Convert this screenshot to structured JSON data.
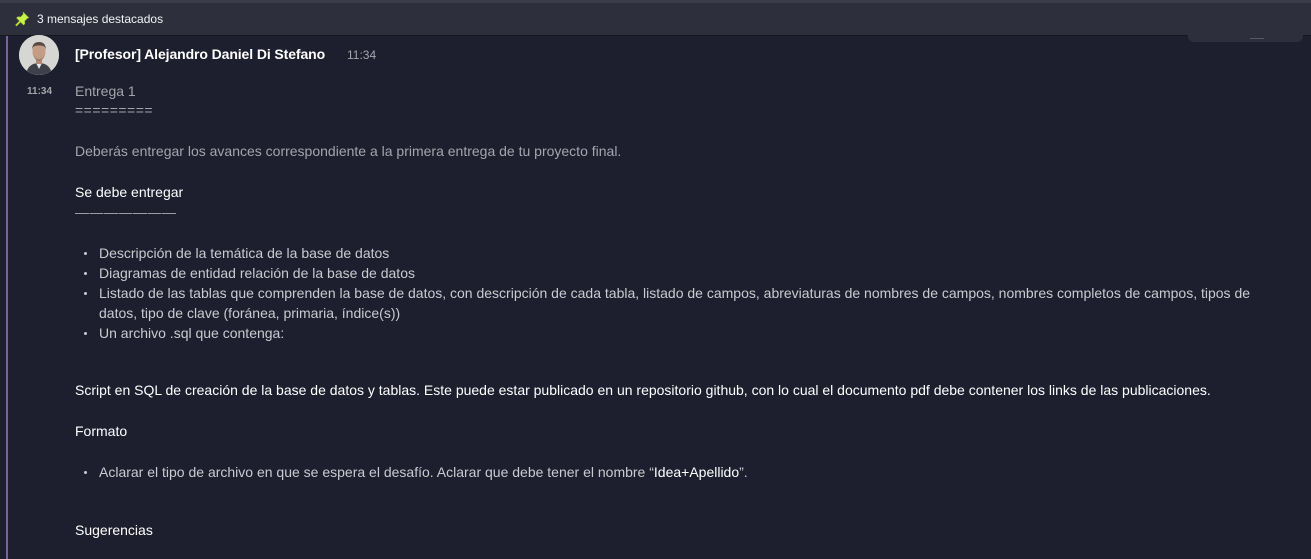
{
  "pinned": {
    "label": "3 mensajes destacados"
  },
  "message": {
    "author": "[Profesor] Alejandro Daniel Di Stefano",
    "timestamp": "11:34",
    "gutter_timestamp": "11:34",
    "title": "Entrega 1",
    "title_underline": "=========",
    "intro": "Deberás entregar los avances correspondiente a la primera entrega de tu proyecto final.",
    "section1_heading": "Se debe entregar",
    "section1_rule": "———————",
    "section1_items": [
      "Descripción de la temática de la base de datos",
      "Diagramas de entidad relación de la base de datos",
      "Listado de las tablas que comprenden la base de datos, con descripción de cada tabla, listado de campos, abreviaturas de nombres de campos, nombres completos de campos, tipos de datos, tipo de clave (foránea, primaria, índice(s))",
      "Un archivo .sql que contenga:"
    ],
    "script_paragraph": "Script en SQL de creación de la base de datos y tablas. Este puede estar publicado en un repositorio github, con lo cual el documento pdf debe contener los links de las publicaciones.",
    "section2_heading": "Formato",
    "format_item_prefix": "Aclarar el tipo de archivo en que se espera el desafío. Aclarar que debe tener el nombre “",
    "format_item_highlight": "Idea+Apellido",
    "format_item_suffix": "”.",
    "section3_heading": "Sugerencias"
  },
  "colors": {
    "background": "#1e1f2e",
    "pinbar": "#2d2f3d",
    "accent": "#7b5ea7",
    "pin_icon": "#c6f24e"
  }
}
